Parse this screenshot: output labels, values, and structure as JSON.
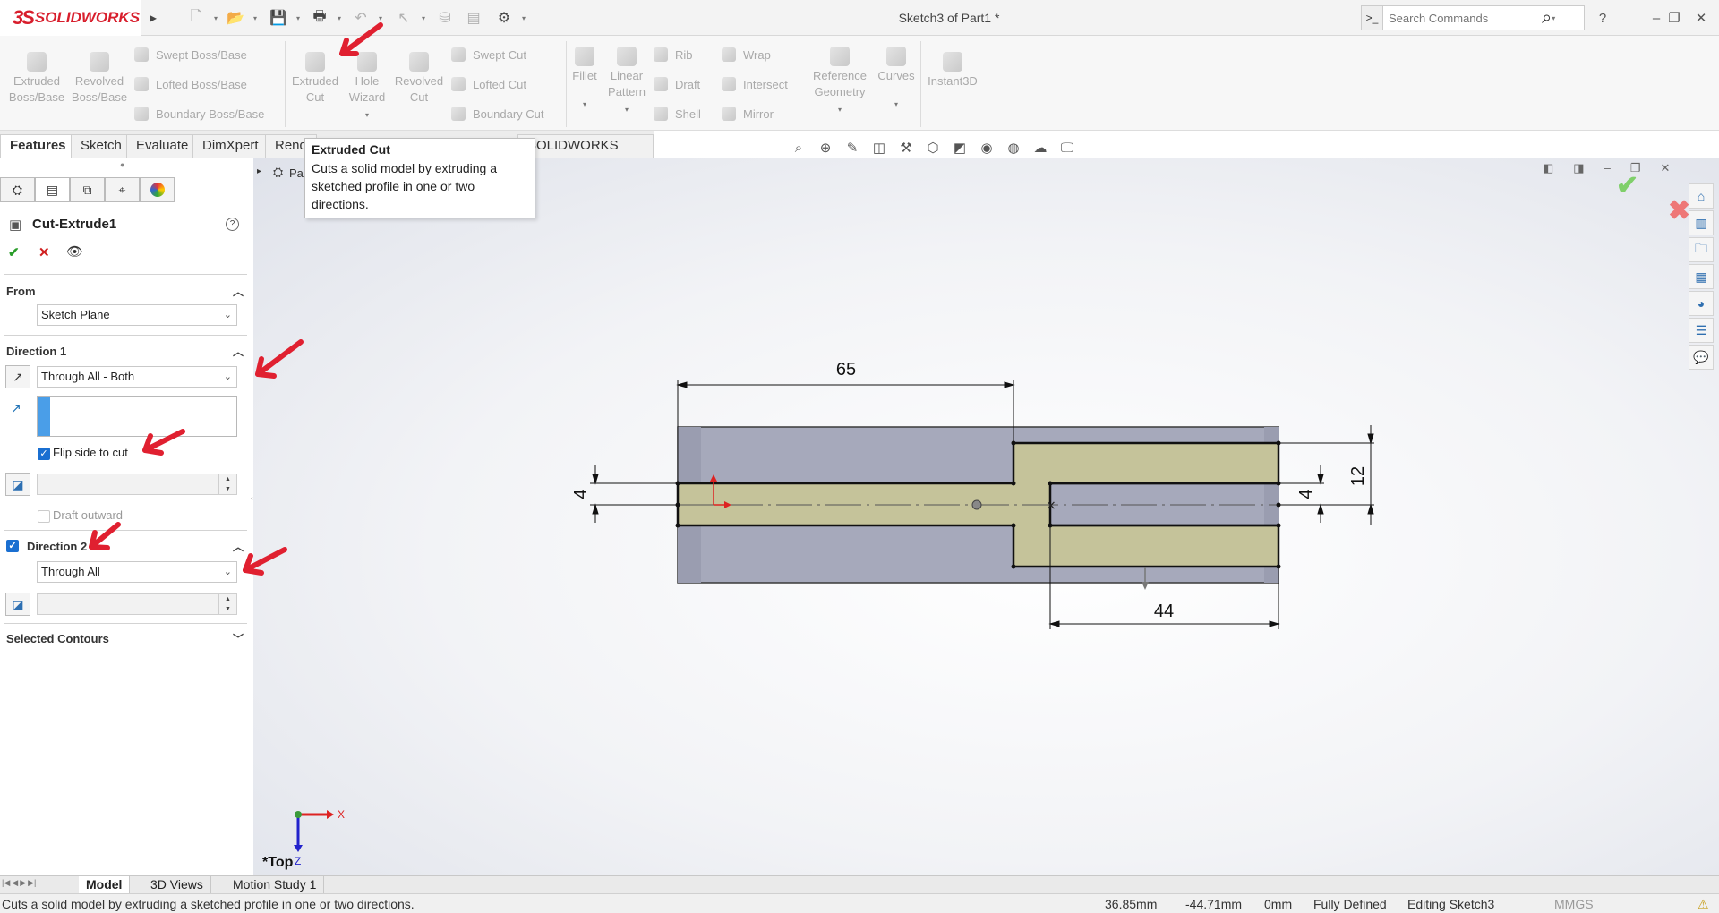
{
  "app": {
    "brand_ds": "3S",
    "brand_name": "SOLIDWORKS",
    "doc_title": "Sketch3 of Part1 *"
  },
  "search": {
    "placeholder": "Search Commands"
  },
  "window_buttons": {
    "help": "?",
    "minimize": "–",
    "restore": "❐",
    "close": "✕"
  },
  "ribbon": {
    "extruded_boss": "Extruded\nBoss/Base",
    "revolved_boss": "Revolved\nBoss/Base",
    "swept_boss": "Swept Boss/Base",
    "lofted_boss": "Lofted Boss/Base",
    "boundary_boss": "Boundary Boss/Base",
    "extruded_cut": "Extruded\nCut",
    "hole_wizard": "Hole\nWizard",
    "revolved_cut": "Revolved\nCut",
    "swept_cut": "Swept Cut",
    "lofted_cut": "Lofted Cut",
    "boundary_cut": "Boundary Cut",
    "fillet": "Fillet",
    "linear_pattern": "Linear\nPattern",
    "rib": "Rib",
    "draft": "Draft",
    "shell": "Shell",
    "wrap": "Wrap",
    "intersect": "Intersect",
    "mirror": "Mirror",
    "reference_geometry": "Reference\nGeometry",
    "curves": "Curves",
    "instant3d": "Instant3D"
  },
  "command_tabs": [
    "Features",
    "Sketch",
    "Evaluate",
    "DimXpert",
    "Rend",
    "SOLIDWORKS MBD"
  ],
  "tooltip": {
    "title": "Extruded Cut",
    "description": "Cuts a solid model by extruding a sketched profile in one or two directions."
  },
  "feature_tree_partial": "Pa",
  "property_manager": {
    "title": "Cut-Extrude1",
    "from_label": "From",
    "from_value": "Sketch Plane",
    "direction1_label": "Direction 1",
    "direction1_value": "Through All - Both",
    "flip_side_label": "Flip side to cut",
    "flip_side_checked": true,
    "draft_outward_label": "Draft outward",
    "direction2_label": "Direction 2",
    "direction2_checked": true,
    "direction2_value": "Through All",
    "selected_contours_label": "Selected Contours"
  },
  "sketch": {
    "dim_top": "65",
    "dim_bottom": "44",
    "dim_left": "4",
    "dim_right_inner": "4",
    "dim_right_outer": "12"
  },
  "triad": {
    "x_label": "X",
    "z_label": "Z",
    "view_name": "*Top"
  },
  "bottom_tabs": [
    "Model",
    "3D Views",
    "Motion Study 1"
  ],
  "status": {
    "message": "Cuts a solid model by extruding a sketched profile in one or two directions.",
    "x": "36.85mm",
    "y": "-44.71mm",
    "z": "0mm",
    "state": "Fully Defined",
    "editing": "Editing Sketch3",
    "units": "MMGS"
  },
  "colors": {
    "brand_red": "#d81e2c",
    "annotation_red": "#e02030",
    "sketch_fill": "#c5c39a",
    "body_gray": "#a6a9bb",
    "accept_green": "#6abf4b",
    "cancel_red": "#e34a4a"
  }
}
